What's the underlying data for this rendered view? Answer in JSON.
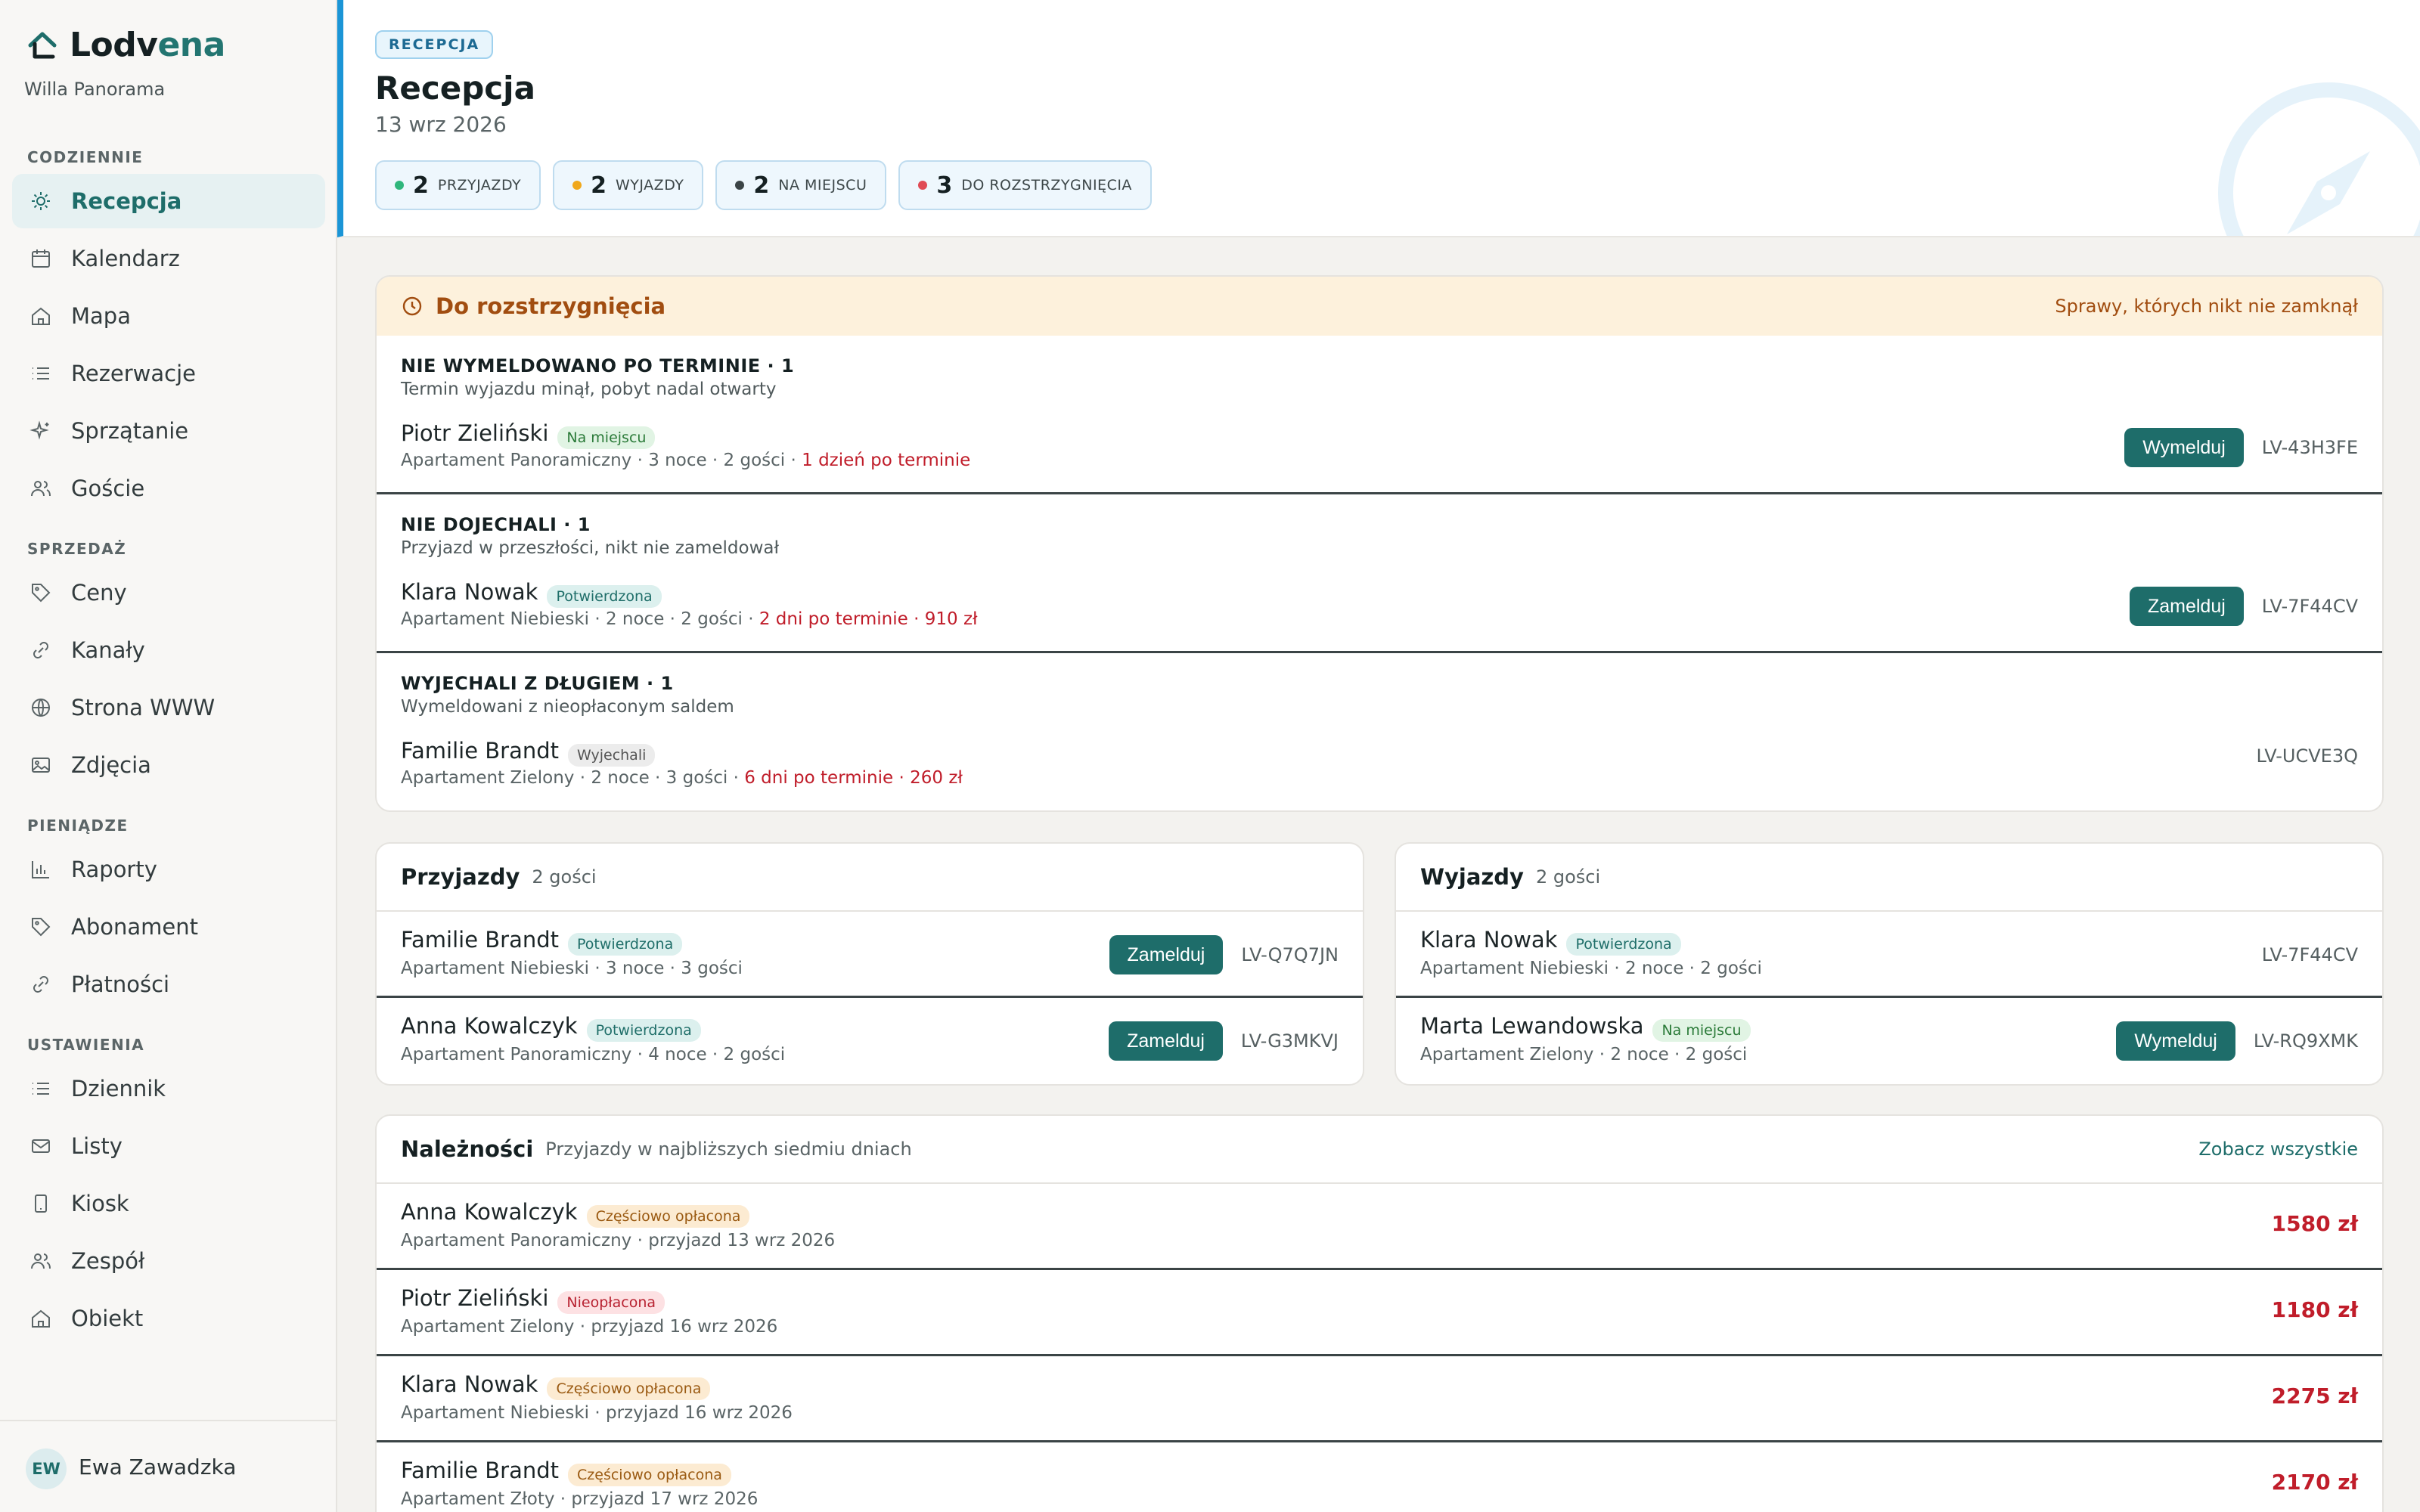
{
  "app": {
    "brand_part1": "Lodv",
    "brand_part2": "ena",
    "property": "Willa Panorama",
    "accent_color": "#1e6d6a",
    "header_bar_color": "#1b95d6"
  },
  "sidebar": {
    "sections": [
      {
        "label": "CODZIENNIE"
      },
      {
        "label": "SPRZEDAŻ"
      },
      {
        "label": "PIENIĄDZE"
      },
      {
        "label": "USTAWIENIA"
      }
    ],
    "items": [
      {
        "label": "Recepcja",
        "icon": "sun-icon",
        "active": true
      },
      {
        "label": "Kalendarz",
        "icon": "calendar-icon"
      },
      {
        "label": "Mapa",
        "icon": "home-icon"
      },
      {
        "label": "Rezerwacje",
        "icon": "list-icon"
      },
      {
        "label": "Sprzątanie",
        "icon": "sparkle-icon"
      },
      {
        "label": "Goście",
        "icon": "users-icon"
      },
      {
        "label": "Ceny",
        "icon": "tag-icon"
      },
      {
        "label": "Kanały",
        "icon": "link-icon"
      },
      {
        "label": "Strona WWW",
        "icon": "globe-icon"
      },
      {
        "label": "Zdjęcia",
        "icon": "image-icon"
      },
      {
        "label": "Raporty",
        "icon": "bar-chart-icon"
      },
      {
        "label": "Abonament",
        "icon": "tag-icon"
      },
      {
        "label": "Płatności",
        "icon": "link-icon"
      },
      {
        "label": "Dziennik",
        "icon": "list-icon"
      },
      {
        "label": "Listy",
        "icon": "mail-icon"
      },
      {
        "label": "Kiosk",
        "icon": "tablet-icon"
      },
      {
        "label": "Zespół",
        "icon": "users-icon"
      },
      {
        "label": "Obiekt",
        "icon": "home-icon"
      }
    ],
    "user": {
      "initials": "EW",
      "name": "Ewa Zawadzka"
    }
  },
  "header": {
    "tag": "RECEPCJA",
    "title": "Recepcja",
    "date": "13 wrz 2026",
    "stats": [
      {
        "value": "2",
        "label": "PRZYJAZDY",
        "color": "#2fb67c"
      },
      {
        "value": "2",
        "label": "WYJAZDY",
        "color": "#f0a81c"
      },
      {
        "value": "2",
        "label": "NA MIEJSCU",
        "color": "#3b4446"
      },
      {
        "value": "3",
        "label": "DO ROZSTRZYGNIĘCIA",
        "color": "#e04b55"
      }
    ]
  },
  "pending": {
    "title": "Do rozstrzygnięcia",
    "subtitle": "Sprawy, których nikt nie zamknął",
    "groups": [
      {
        "title": "NIE WYMELDOWANO PO TERMINIE · 1",
        "desc": "Termin wyjazdu minął, pobyt nadal otwarty",
        "name": "Piotr Zieliński",
        "badge": "Na miejscu",
        "meta": "Apartament Panoramiczny · 3 noce · 2 gości · ",
        "late": "1 dzień po terminie",
        "action": "Wymelduj",
        "code": "LV-43H3FE"
      },
      {
        "title": "NIE DOJECHALI · 1",
        "desc": "Przyjazd w przeszłości, nikt nie zameldował",
        "name": "Klara Nowak",
        "badge": "Potwierdzona",
        "meta": "Apartament Niebieski · 2 noce · 2 gości · ",
        "late": "2 dni po terminie · 910 zł",
        "action": "Zamelduj",
        "code": "LV-7F44CV"
      },
      {
        "title": "WYJECHALI Z DŁUGIEM · 1",
        "desc": "Wymeldowani z nieopłaconym saldem",
        "name": "Familie Brandt",
        "badge": "Wyjechali",
        "meta": "Apartament Zielony · 2 noce · 3 gości · ",
        "late": "6 dni po terminie · 260 zł",
        "action": "",
        "code": "LV-UCVE3Q"
      }
    ]
  },
  "arrivals": {
    "title": "Przyjazdy",
    "count": "2 gości",
    "rows": [
      {
        "name": "Familie Brandt",
        "badge": "Potwierdzona",
        "meta": "Apartament Niebieski · 3 noce · 3 gości",
        "action": "Zamelduj",
        "code": "LV-Q7Q7JN"
      },
      {
        "name": "Anna Kowalczyk",
        "badge": "Potwierdzona",
        "meta": "Apartament Panoramiczny · 4 noce · 2 gości",
        "action": "Zamelduj",
        "code": "LV-G3MKVJ"
      }
    ]
  },
  "departures": {
    "title": "Wyjazdy",
    "count": "2 gości",
    "rows": [
      {
        "name": "Klara Nowak",
        "badge": "Potwierdzona",
        "meta": "Apartament Niebieski · 2 noce · 2 gości",
        "action": "",
        "code": "LV-7F44CV"
      },
      {
        "name": "Marta Lewandowska",
        "badge": "Na miejscu",
        "meta": "Apartament Zielony · 2 noce · 2 gości",
        "action": "Wymelduj",
        "code": "LV-RQ9XMK"
      }
    ]
  },
  "dues": {
    "title": "Należności",
    "subtitle": "Przyjazdy w najbliższych siedmiu dniach",
    "link": "Zobacz wszystkie",
    "rows": [
      {
        "name": "Anna Kowalczyk",
        "badge": "Częściowo opłacona",
        "meta": "Apartament Panoramiczny · przyjazd 13 wrz 2026",
        "amount": "1580 zł"
      },
      {
        "name": "Piotr Zieliński",
        "badge": "Nieopłacona",
        "meta": "Apartament Zielony · przyjazd 16 wrz 2026",
        "amount": "1180 zł"
      },
      {
        "name": "Klara Nowak",
        "badge": "Częściowo opłacona",
        "meta": "Apartament Niebieski · przyjazd 16 wrz 2026",
        "amount": "2275 zł"
      },
      {
        "name": "Familie Brandt",
        "badge": "Częściowo opłacona",
        "meta": "Apartament Złoty · przyjazd 17 wrz 2026",
        "amount": "2170 zł"
      }
    ]
  }
}
